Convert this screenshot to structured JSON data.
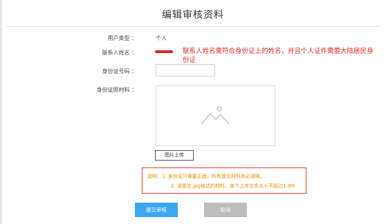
{
  "page": {
    "title": "编辑审核资料"
  },
  "form": {
    "user_type_label": "用户类型 ：",
    "user_type_value": "个人",
    "contact_name_label": "联系人姓名 ：",
    "contact_name_warning": "联系人姓名需符合身份证上的姓名，并且个人证件需要大陆居民身份证",
    "id_number_label": "身份证号码 ：",
    "id_number_value": "",
    "id_photo_label": "身份证照材料 ：",
    "upload_button": "图片上传"
  },
  "notice": {
    "line1": "说明：1. 身份证只需要正面，所有提交材料务必清晰。",
    "line2": "2. 请提交.jpg格式的材料，单个上传文件大小不超过1.9M"
  },
  "actions": {
    "submit": "提交审核",
    "cancel": "取消"
  },
  "colors": {
    "warning_red": "#e62626",
    "notice_orange": "#f08a00",
    "submit_blue": "#3ba7f2",
    "cancel_gray": "#bdbdbd"
  }
}
